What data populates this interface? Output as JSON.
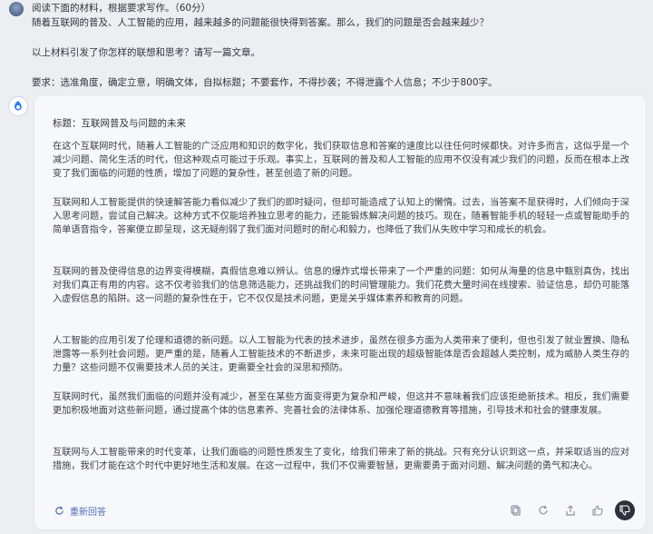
{
  "user": {
    "lines": [
      "阅读下面的材料，根据要求写作。（60分）",
      "随着互联网的普及、人工智能的应用，越来越多的问题能很快得到答案。那么，我们的问题是否会越来越少？",
      "以上材料引发了你怎样的联想和思考？请写一篇文章。",
      "要求：选准角度，确定立意，明确文体，自拟标题；不要套作，不得抄袭；不得泄露个人信息；不少于800字。"
    ]
  },
  "answer": {
    "title": "标题：互联网普及与问题的未来",
    "paragraphs": [
      "在这个互联网时代，随着人工智能的广泛应用和知识的数字化，我们获取信息和答案的速度比以往任何时候都快。对许多而言，这似乎是一个减少问题、简化生活的时代，但这种观点可能过于乐观。事实上，互联网的普及和人工智能的应用不仅没有减少我们的问题，反而在根本上改变了我们面临的问题的性质，增加了问题的复杂性，甚至创造了新的问题。",
      "互联网和人工智能提供的快速解答能力看似减少了我们的即时疑问，但却可能造成了认知上的懒惰。过去，当答案不是获得时，人们倾向于深入思考问题，尝试自己解决。这种方式不仅能培养独立思考的能力，还能锻炼解决问题的技巧。现在，随着智能手机的轻轻一点或智能助手的简单语音指令，答案便立即呈现，这无疑削弱了我们面对问题时的耐心和毅力，也降低了我们从失败中学习和成长的机会。",
      "互联网的普及使得信息的边界变得模糊，真假信息难以辨认。信息的爆炸式增长带来了一个严重的问题：如何从海量的信息中甄别真伪，找出对我们真正有用的内容。这不仅考验我们的信息筛选能力，还挑战我们的时间管理能力。我们花费大量时间在线搜索、验证信息，却仍可能落入虚假信息的陷阱。这一问题的复杂性在于，它不仅仅是技术问题，更是关乎媒体素养和教育的问题。",
      "人工智能的应用引发了伦理和道德的新问题。以人工智能为代表的技术进步，虽然在很多方面为人类带来了便利，但也引发了就业置换、隐私泄露等一系列社会问题。更严重的是，随着人工智能技术的不断进步，未来可能出现的超级智能体是否会超越人类控制，成为威胁人类生存的力量？这些问题不仅需要技术人员的关注，更需要全社会的深思和预防。",
      "互联网时代，虽然我们面临的问题并没有减少，甚至在某些方面变得更为复杂和严峻，但这并不意味着我们应该拒绝新技术。相反，我们需要更加积极地面对这些新问题，通过提高个体的信息素养、完善社会的法律体系、加强伦理道德教育等措施，引导技术和社会的健康发展。",
      "互联网与人工智能带来的时代变革，让我们面临的问题性质发生了变化，给我们带来了新的挑战。只有充分认识到这一点，并采取适当的应对措施，我们才能在这个时代中更好地生活和发展。在这一过程中，我们不仅需要智慧，更需要勇于面对问题、解决问题的勇气和决心。"
    ],
    "regenerate_label": "重新回答"
  },
  "toolbar_icons": [
    "copy-icon",
    "refresh-icon",
    "share-icon",
    "thumbs-up-icon",
    "thumbs-down-icon"
  ],
  "colors": {
    "accent": "#4c6cb3",
    "card_bg": "#f7f8fb",
    "page_bg": "#eceef2"
  }
}
